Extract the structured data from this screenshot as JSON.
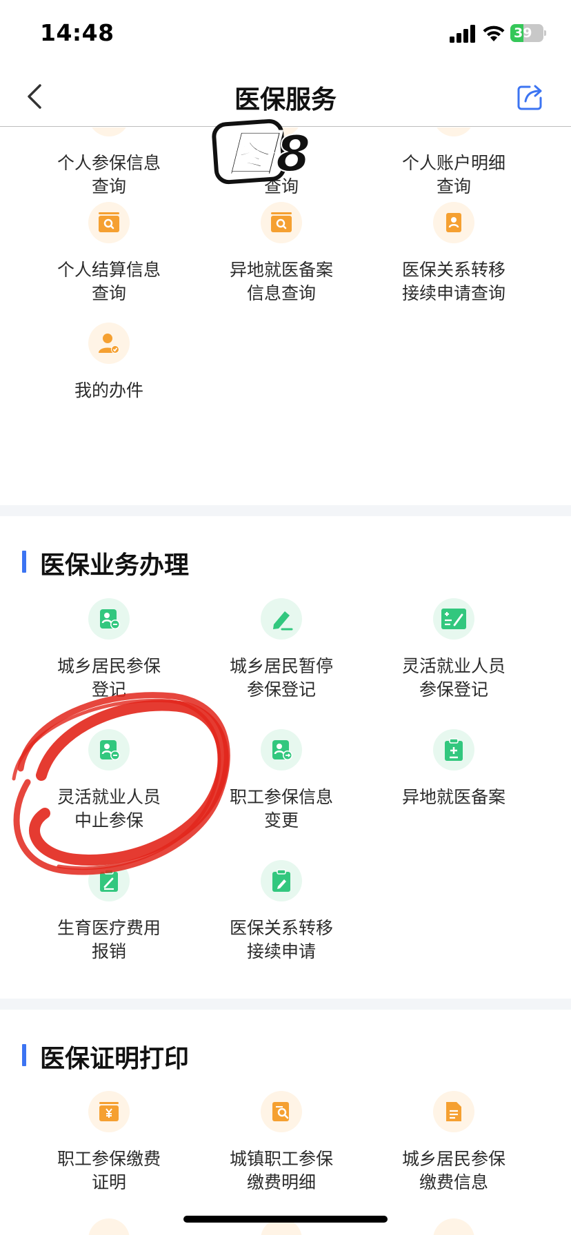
{
  "status_bar": {
    "time": "14:48",
    "battery_level": "39",
    "battery_percent": 39
  },
  "nav": {
    "title": "医保服务",
    "back_icon": "chevron-left-icon",
    "share_icon": "share-icon"
  },
  "stamp": {
    "text": "图8"
  },
  "query_section": {
    "items": [
      {
        "label": "个人参保信息\n查询",
        "icon": "plus-icon"
      },
      {
        "label": "查询",
        "icon": "document-icon"
      },
      {
        "label": "个人账户明细\n查询",
        "icon": "list-icon"
      },
      {
        "label": "个人结算信息\n查询",
        "icon": "search-doc-icon"
      },
      {
        "label": "异地就医备案\n信息查询",
        "icon": "search-doc-icon"
      },
      {
        "label": "医保关系转移\n接续申请查询",
        "icon": "person-doc-icon"
      },
      {
        "label": "我的办件",
        "icon": "user-check-icon"
      }
    ]
  },
  "business_section": {
    "title": "医保业务办理",
    "items": [
      {
        "label": "城乡居民参保\n登记",
        "icon": "person-minus-icon"
      },
      {
        "label": "城乡居民暂停\n参保登记",
        "icon": "pen-icon"
      },
      {
        "label": "灵活就业人员\n参保登记",
        "icon": "sign-form-icon"
      },
      {
        "label": "灵活就业人员\n中止参保",
        "icon": "person-minus-icon"
      },
      {
        "label": "职工参保信息\n变更",
        "icon": "person-arrow-icon"
      },
      {
        "label": "异地就医备案",
        "icon": "clipboard-plus-icon"
      },
      {
        "label": "生育医疗费用\n报销",
        "icon": "clipboard-pen-icon"
      },
      {
        "label": "医保关系转移\n接续申请",
        "icon": "clipboard-edit-icon"
      }
    ]
  },
  "certificate_section": {
    "title": "医保证明打印",
    "items": [
      {
        "label": "职工参保缴费\n证明",
        "icon": "yuan-icon"
      },
      {
        "label": "城镇职工参保\n缴费明细",
        "icon": "search-doc-icon"
      },
      {
        "label": "城乡居民参保\n缴费信息",
        "icon": "document-icon"
      }
    ]
  },
  "colors": {
    "accent_blue": "#3c74f2",
    "icon_orange": "#f5a031",
    "icon_green": "#32c77e",
    "annotation_red": "#e2261b"
  }
}
